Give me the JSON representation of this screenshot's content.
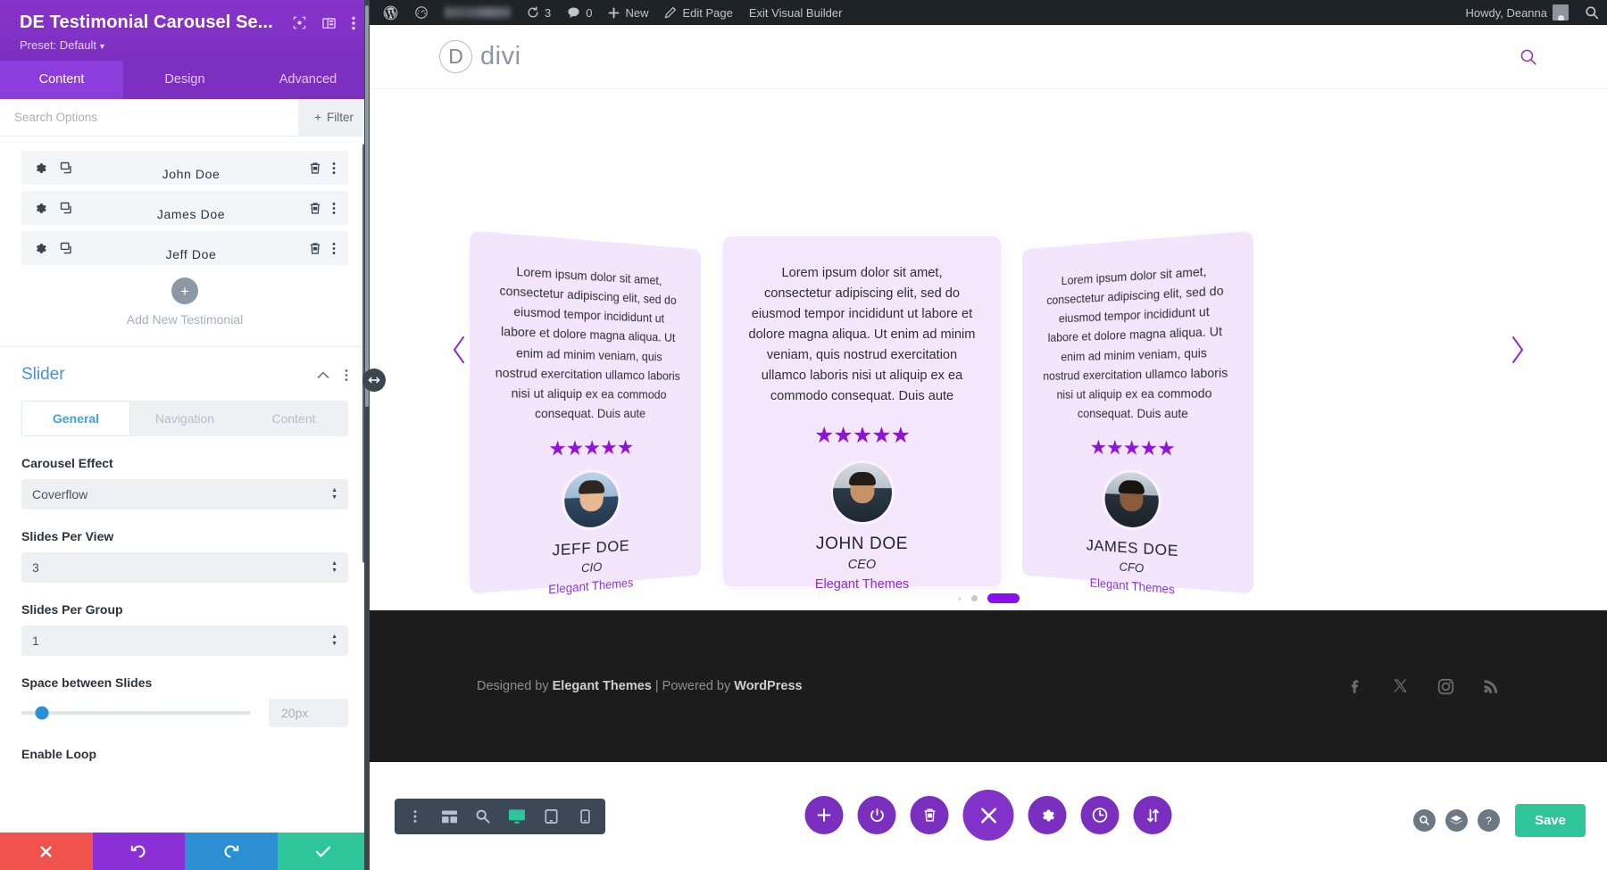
{
  "settings_panel": {
    "module_title": "DE Testimonial Carousel Se...",
    "preset_label": "Preset: Default",
    "header_icons": [
      "focus-target-icon",
      "layout-split-icon",
      "vertical-dots-icon"
    ],
    "tabs": [
      {
        "label": "Content",
        "active": true
      },
      {
        "label": "Design",
        "active": false
      },
      {
        "label": "Advanced",
        "active": false
      }
    ],
    "search": {
      "placeholder": "Search Options",
      "value": ""
    },
    "filter_label": "Filter",
    "testimonials": [
      {
        "name": "John Doe"
      },
      {
        "name": "James Doe"
      },
      {
        "name": "Jeff Doe"
      }
    ],
    "add_new_label": "Add New Testimonial",
    "slider": {
      "section_title": "Slider",
      "sub_tabs": [
        {
          "label": "General",
          "active": true
        },
        {
          "label": "Navigation",
          "active": false
        },
        {
          "label": "Content",
          "active": false
        }
      ],
      "fields": [
        {
          "label": "Carousel Effect",
          "value": "Coverflow",
          "type": "select"
        },
        {
          "label": "Slides Per View",
          "value": "3",
          "type": "select"
        },
        {
          "label": "Slides Per Group",
          "value": "1",
          "type": "select"
        }
      ],
      "space_between": {
        "label": "Space between Slides",
        "value": "20px",
        "slider_percent": 9
      },
      "enable_loop_label": "Enable Loop"
    },
    "footer_buttons": [
      {
        "name": "discard-changes",
        "icon": "x-icon",
        "color": "#f0524d"
      },
      {
        "name": "undo",
        "icon": "undo-icon",
        "color": "#8b2fd6"
      },
      {
        "name": "redo",
        "icon": "redo-icon",
        "color": "#2b8fd1"
      },
      {
        "name": "save-changes",
        "icon": "check-icon",
        "color": "#2fc59b"
      }
    ]
  },
  "admin_bar": {
    "wp_logo": "wordpress-logo-icon",
    "dashboard_icon": "dashboard-icon",
    "site_name": "",
    "updates_count": "3",
    "comments_count": "0",
    "new_label": "New",
    "edit_page_label": "Edit Page",
    "exit_builder_label": "Exit Visual Builder",
    "howdy_label": "Howdy, Deanna",
    "search_icon": "search-icon"
  },
  "site_header": {
    "logo_letter": "D",
    "logo_word": "divi",
    "search_icon": "search-icon"
  },
  "carousel": {
    "prev_arrow": "chevron-left-icon",
    "next_arrow": "chevron-right-icon",
    "quote_text": "Lorem ipsum dolor sit amet, consectetur adipiscing elit, sed do eiusmod tempor incididunt ut labore et dolore magna aliqua. Ut enim ad minim veniam, quis nostrud exercitation ullamco laboris nisi ut aliquip ex ea commodo consequat. Duis aute",
    "stars": "★★★★★",
    "slides": [
      {
        "position": "left",
        "name": "JEFF DOE",
        "role": "CIO",
        "company": "Elegant Themes",
        "avatar": "avatar-jeff"
      },
      {
        "position": "center",
        "name": "JOHN DOE",
        "role": "CEO",
        "company": "Elegant Themes",
        "avatar": "avatar-john"
      },
      {
        "position": "right",
        "name": "JAMES DOE",
        "role": "CFO",
        "company": "Elegant Themes",
        "avatar": "avatar-james"
      }
    ],
    "pagination": [
      {
        "state": "tiny"
      },
      {
        "state": "inactive"
      },
      {
        "state": "active"
      }
    ]
  },
  "site_footer": {
    "designed_by": "Designed by ",
    "designer": "Elegant Themes",
    "separator": " | ",
    "powered_by": "Powered by ",
    "platform": "WordPress",
    "social": [
      "facebook-icon",
      "x-twitter-icon",
      "instagram-icon",
      "rss-icon"
    ]
  },
  "builder_bar": {
    "responsive_tools": [
      {
        "name": "more-options-icon",
        "active": false
      },
      {
        "name": "wireframe-view-icon",
        "active": false
      },
      {
        "name": "zoom-out-view-icon",
        "active": false
      },
      {
        "name": "desktop-view-icon",
        "active": true
      },
      {
        "name": "tablet-view-icon",
        "active": false
      },
      {
        "name": "phone-view-icon",
        "active": false
      }
    ],
    "center_actions": [
      {
        "name": "add-module-icon",
        "big": false
      },
      {
        "name": "power-toggle-icon",
        "big": false
      },
      {
        "name": "trash-icon",
        "big": false
      },
      {
        "name": "close-builder-icon",
        "big": true
      },
      {
        "name": "settings-gear-icon",
        "big": false
      },
      {
        "name": "history-clock-icon",
        "big": false
      },
      {
        "name": "portability-icon",
        "big": false
      }
    ],
    "right_actions": [
      {
        "name": "search-icon",
        "glyph": "⚲"
      },
      {
        "name": "layers-icon",
        "glyph": "≣"
      },
      {
        "name": "help-icon",
        "glyph": "?"
      }
    ],
    "save_label": "Save"
  },
  "colors": {
    "panel_purple": "#7d2fc0",
    "accent_blue": "#3ba3e0",
    "card_bg": "#f4e6fb",
    "star_purple": "#9013d8",
    "company_purple": "#8a2be2",
    "save_green": "#2fc59b",
    "admin_bar": "#1d2327",
    "footer_bg": "#1c1c1c"
  }
}
